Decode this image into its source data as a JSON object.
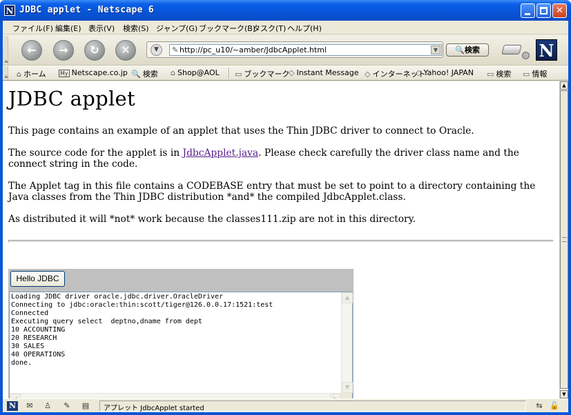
{
  "window": {
    "title": "JDBC applet - Netscape 6"
  },
  "menu": [
    "ファイル(F)",
    "編集(E)",
    "表示(V)",
    "検索(S)",
    "ジャンプ(G)",
    "ブックマーク(B)",
    "タスク(T)",
    "ヘルプ(H)"
  ],
  "nav": {
    "url": "http://pc_u10/~amber/JdbcApplet.html",
    "search_label": "検索",
    "logo": "N"
  },
  "personal_toolbar": [
    "ホーム",
    "Netscape.co.jp",
    "検索",
    "Shop@AOL",
    "ブックマーク",
    "Instant Message",
    "インターネット",
    "Yahoo! JAPAN",
    "検索",
    "情報"
  ],
  "personal_toolbar_prefix": {
    "mynetscape": "My"
  },
  "page": {
    "heading": "JDBC applet",
    "p1": "This page contains an example of an applet that uses the Thin JDBC driver to connect to Oracle.",
    "p2_before": "The source code for the applet is in ",
    "p2_link": "JdbcApplet.java",
    "p2_after": ". Please check carefully the driver class name and the connect string in the code.",
    "p3": "The Applet tag in this file contains a CODEBASE entry that must be set to point to a directory containing the Java classes from the Thin JDBC distribution *and* the compiled JdbcApplet.class.",
    "p4": "As distributed it will *not* work because the classes111.zip are not in this directory."
  },
  "applet": {
    "button_label": "Hello JDBC",
    "console_lines": [
      "Loading JDBC driver oracle.jdbc.driver.OracleDriver",
      "Connecting to jdbc:oracle:thin:scott/tiger@126.0.0.17:1521:test",
      "Connected",
      "Executing query select  deptno,dname from dept",
      "10 ACCOUNTING",
      "20 RESEARCH",
      "30 SALES",
      "40 OPERATIONS",
      "done."
    ]
  },
  "status": {
    "text": "アプレット JdbcApplet started"
  }
}
